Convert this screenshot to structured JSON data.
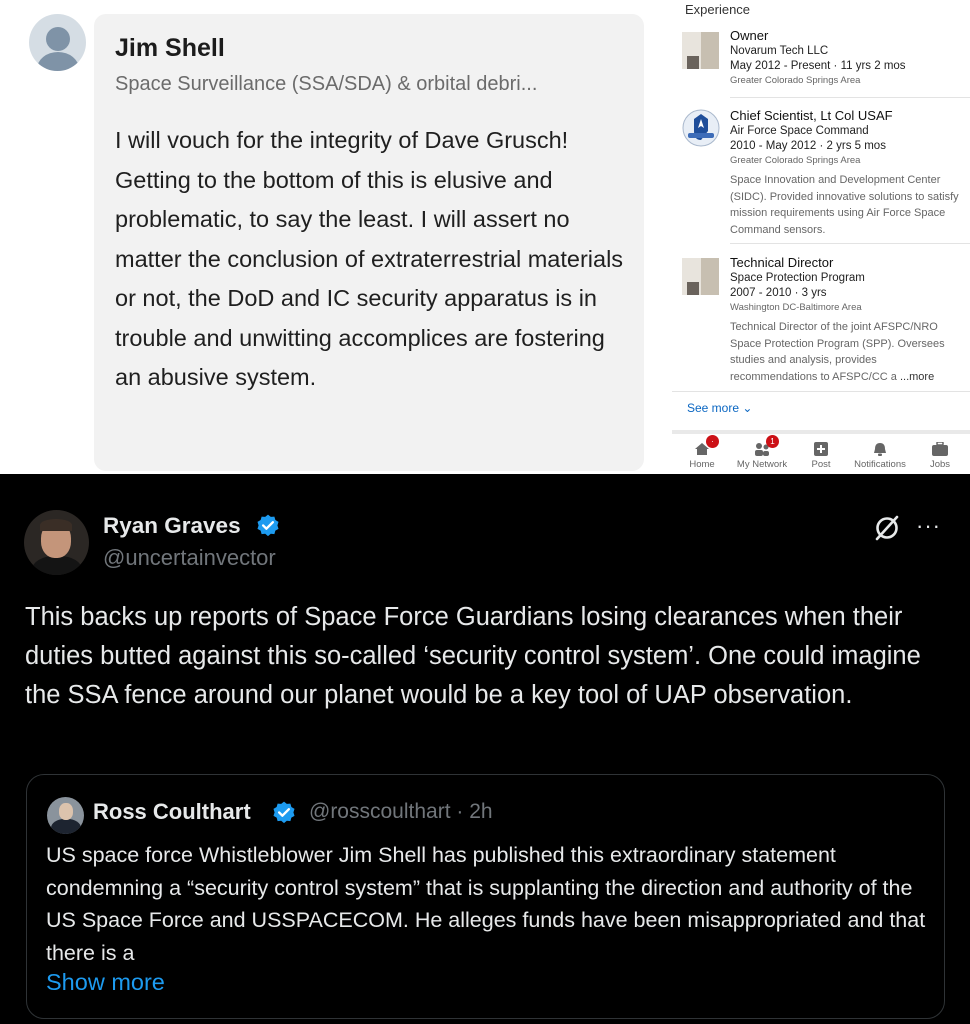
{
  "comment": {
    "author": "Jim Shell",
    "headline": "Space Surveillance (SSA/SDA) & orbital debri...",
    "text": "I will vouch for the integrity of Dave Grusch! Getting to the bottom of this is elusive and problematic, to say the least. I will assert no matter the conclusion of extraterrestrial materials or not, the DoD and IC security apparatus is in trouble and unwitting accomplices are fostering an abusive system."
  },
  "experience": {
    "title": "Experience",
    "jobs": [
      {
        "title": "Owner",
        "org": "Novarum Tech LLC",
        "dates": "May 2012 - Present  ·  11 yrs 2 mos",
        "location": "Greater Colorado Springs Area"
      },
      {
        "title": "Chief Scientist, Lt Col USAF",
        "org": "Air Force Space Command",
        "dates": "2010 - May 2012  ·  2 yrs 5 mos",
        "location": "Greater Colorado Springs Area",
        "description": "Space Innovation and Development Center (SIDC). Provided innovative solutions to satisfy mission requirements using Air Force Space Command sensors."
      },
      {
        "title": "Technical Director",
        "org": "Space Protection Program",
        "dates": "2007 - 2010  ·  3 yrs",
        "location": "Washington DC-Baltimore Area",
        "description": "Technical Director of the joint AFSPC/NRO Space Protection Program (SPP). Oversees studies and analysis, provides recommendations to AFSPC/CC a",
        "more": "...more"
      }
    ],
    "see_more": "See more"
  },
  "bottom_nav": [
    {
      "label": "Home",
      "icon": "home-icon",
      "badge": "·"
    },
    {
      "label": "My Network",
      "icon": "network-icon",
      "badge": "1"
    },
    {
      "label": "Post",
      "icon": "post-icon"
    },
    {
      "label": "Notifications",
      "icon": "bell-icon"
    },
    {
      "label": "Jobs",
      "icon": "briefcase-icon"
    }
  ],
  "tweet": {
    "name": "Ryan Graves",
    "handle": "@uncertainvector",
    "text": "This backs up reports of Space Force Guardians losing clearances when their duties butted against this so-called ‘security control system’. One could imagine the SSA fence around our planet would be a key tool of UAP observation.",
    "more_icon": "···",
    "quote": {
      "name": "Ross Coulthart",
      "handle_time": "@rosscoulthart · 2h",
      "text": "US space force Whistleblower Jim Shell has published this extraordinary statement condemning a “security control system” that is supplanting the direction and authority of the US Space Force and USSPACECOM.  He alleges funds have been misappropriated and that there is a",
      "show_more": "Show more"
    }
  },
  "colors": {
    "verified": "#1d9bf0",
    "link": "#0a66c2",
    "badge": "#cc1016"
  }
}
